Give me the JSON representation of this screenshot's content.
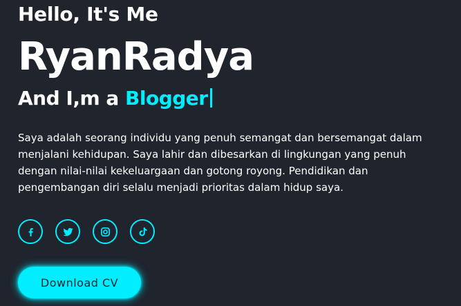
{
  "hero": {
    "greeting": "Hello, It's Me",
    "name": "RyanRadya",
    "role_prefix": "And I,m a ",
    "role_word": "Blogger",
    "bio": "Saya adalah seorang individu yang penuh semangat dan bersemangat dalam menjalani kehidupan. Saya lahir dan dibesarkan di lingkungan yang penuh dengan nilai-nilai kekeluargaan dan gotong royong. Pendidikan dan pengembangan diri selalu menjadi prioritas dalam hidup saya."
  },
  "socials": [
    {
      "icon": "facebook-icon"
    },
    {
      "icon": "twitter-icon"
    },
    {
      "icon": "instagram-icon"
    },
    {
      "icon": "tiktok-icon"
    }
  ],
  "cta": {
    "label": "Download CV"
  },
  "colors": {
    "background": "#1f242d",
    "accent": "#00eeff",
    "text": "#ffffff"
  }
}
